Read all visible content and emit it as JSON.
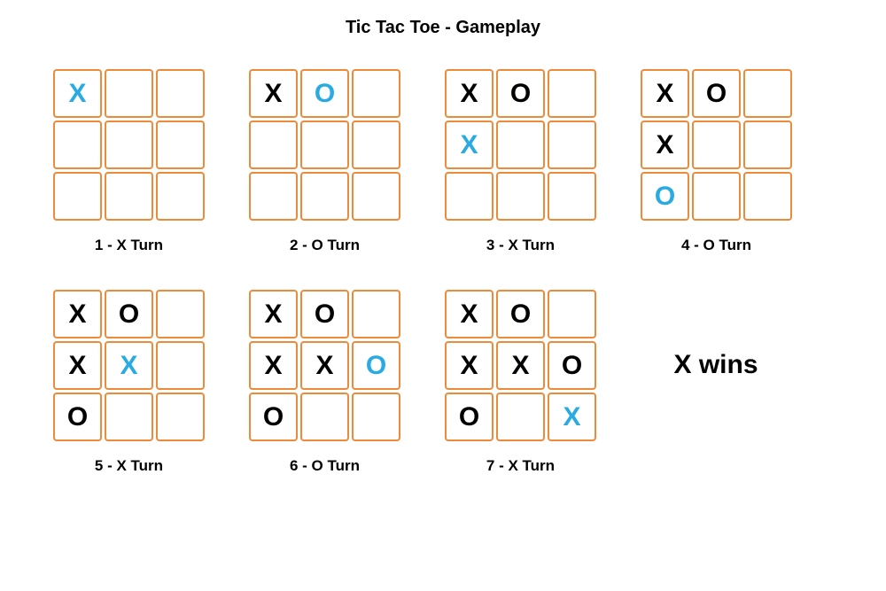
{
  "title": "Tic Tac Toe - Gameplay",
  "result_text": "X wins",
  "boards": [
    {
      "caption": "1 - X Turn",
      "cells": [
        {
          "v": "X",
          "c": "blue"
        },
        {
          "v": "",
          "c": ""
        },
        {
          "v": "",
          "c": ""
        },
        {
          "v": "",
          "c": ""
        },
        {
          "v": "",
          "c": ""
        },
        {
          "v": "",
          "c": ""
        },
        {
          "v": "",
          "c": ""
        },
        {
          "v": "",
          "c": ""
        },
        {
          "v": "",
          "c": ""
        }
      ]
    },
    {
      "caption": "2 - O Turn",
      "cells": [
        {
          "v": "X",
          "c": "black"
        },
        {
          "v": "O",
          "c": "blue"
        },
        {
          "v": "",
          "c": ""
        },
        {
          "v": "",
          "c": ""
        },
        {
          "v": "",
          "c": ""
        },
        {
          "v": "",
          "c": ""
        },
        {
          "v": "",
          "c": ""
        },
        {
          "v": "",
          "c": ""
        },
        {
          "v": "",
          "c": ""
        }
      ]
    },
    {
      "caption": "3 - X Turn",
      "cells": [
        {
          "v": "X",
          "c": "black"
        },
        {
          "v": "O",
          "c": "black"
        },
        {
          "v": "",
          "c": ""
        },
        {
          "v": "X",
          "c": "blue"
        },
        {
          "v": "",
          "c": ""
        },
        {
          "v": "",
          "c": ""
        },
        {
          "v": "",
          "c": ""
        },
        {
          "v": "",
          "c": ""
        },
        {
          "v": "",
          "c": ""
        }
      ]
    },
    {
      "caption": "4 - O Turn",
      "cells": [
        {
          "v": "X",
          "c": "black"
        },
        {
          "v": "O",
          "c": "black"
        },
        {
          "v": "",
          "c": ""
        },
        {
          "v": "X",
          "c": "black"
        },
        {
          "v": "",
          "c": ""
        },
        {
          "v": "",
          "c": ""
        },
        {
          "v": "O",
          "c": "blue"
        },
        {
          "v": "",
          "c": ""
        },
        {
          "v": "",
          "c": ""
        }
      ]
    },
    {
      "caption": "5 - X Turn",
      "cells": [
        {
          "v": "X",
          "c": "black"
        },
        {
          "v": "O",
          "c": "black"
        },
        {
          "v": "",
          "c": ""
        },
        {
          "v": "X",
          "c": "black"
        },
        {
          "v": "X",
          "c": "blue"
        },
        {
          "v": "",
          "c": ""
        },
        {
          "v": "O",
          "c": "black"
        },
        {
          "v": "",
          "c": ""
        },
        {
          "v": "",
          "c": ""
        }
      ]
    },
    {
      "caption": "6 - O Turn",
      "cells": [
        {
          "v": "X",
          "c": "black"
        },
        {
          "v": "O",
          "c": "black"
        },
        {
          "v": "",
          "c": ""
        },
        {
          "v": "X",
          "c": "black"
        },
        {
          "v": "X",
          "c": "black"
        },
        {
          "v": "O",
          "c": "blue"
        },
        {
          "v": "O",
          "c": "black"
        },
        {
          "v": "",
          "c": ""
        },
        {
          "v": "",
          "c": ""
        }
      ]
    },
    {
      "caption": "7 - X Turn",
      "cells": [
        {
          "v": "X",
          "c": "black"
        },
        {
          "v": "O",
          "c": "black"
        },
        {
          "v": "",
          "c": ""
        },
        {
          "v": "X",
          "c": "black"
        },
        {
          "v": "X",
          "c": "black"
        },
        {
          "v": "O",
          "c": "black"
        },
        {
          "v": "O",
          "c": "black"
        },
        {
          "v": "",
          "c": ""
        },
        {
          "v": "X",
          "c": "blue"
        }
      ]
    }
  ]
}
